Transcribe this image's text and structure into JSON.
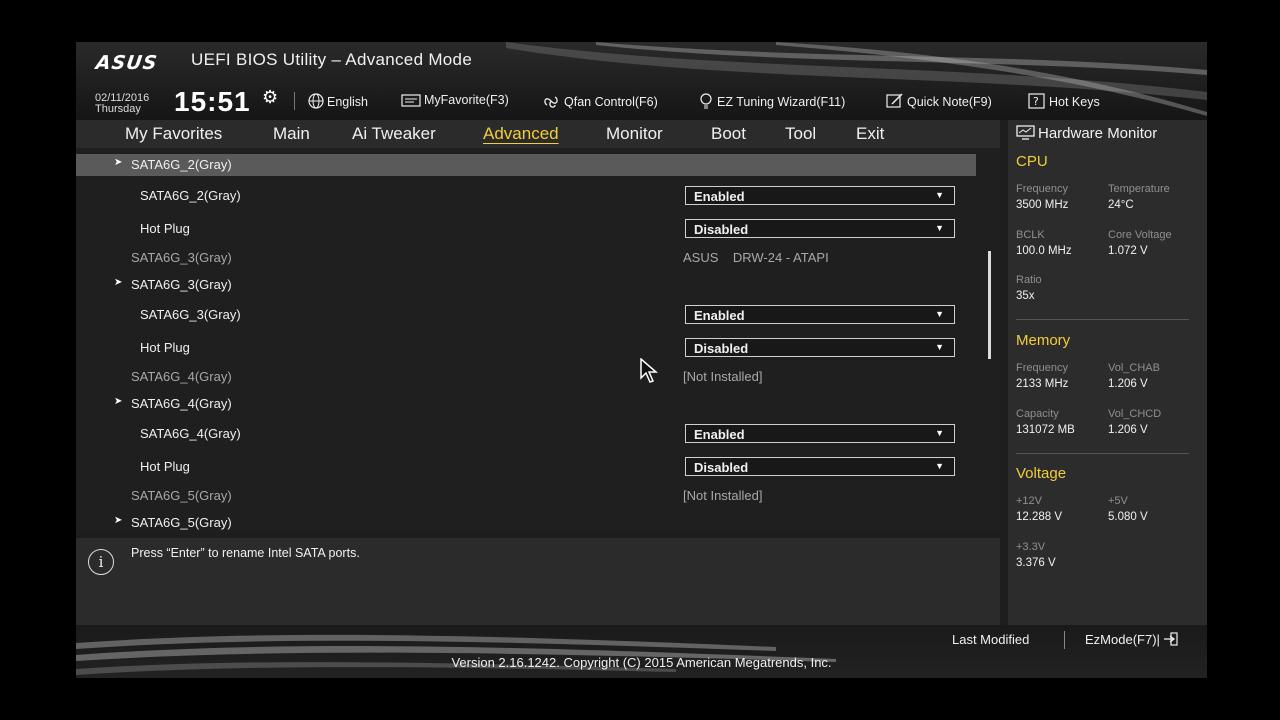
{
  "window": {
    "logo": "ASUS",
    "title": "UEFI BIOS Utility – Advanced Mode"
  },
  "clock": {
    "date": "02/11/2016",
    "weekday": "Thursday",
    "time": "15:51"
  },
  "toolbar": {
    "language": "English",
    "myfavorite": "MyFavorite(F3)",
    "qfan": "Qfan Control(F6)",
    "ez_tuning": "EZ Tuning Wizard(F11)",
    "quick_note": "Quick Note(F9)",
    "hot_keys": "Hot Keys"
  },
  "tabs": [
    "My Favorites",
    "Main",
    "Ai Tweaker",
    "Advanced",
    "Monitor",
    "Boot",
    "Tool",
    "Exit"
  ],
  "active_tab": "Advanced",
  "rows": [
    {
      "type": "header",
      "label": "SATA6G_2(Gray)",
      "highlighted": true
    },
    {
      "type": "setting",
      "label": "SATA6G_2(Gray)",
      "value": "Enabled"
    },
    {
      "type": "setting",
      "label": "Hot Plug",
      "value": "Disabled"
    },
    {
      "type": "info",
      "label": "SATA6G_3(Gray)",
      "value": "ASUS    DRW-24 - ATAPI"
    },
    {
      "type": "header",
      "label": "SATA6G_3(Gray)"
    },
    {
      "type": "setting",
      "label": "SATA6G_3(Gray)",
      "value": "Enabled"
    },
    {
      "type": "setting",
      "label": "Hot Plug",
      "value": "Disabled"
    },
    {
      "type": "info",
      "label": "SATA6G_4(Gray)",
      "value": "[Not Installed]"
    },
    {
      "type": "header",
      "label": "SATA6G_4(Gray)"
    },
    {
      "type": "setting",
      "label": "SATA6G_4(Gray)",
      "value": "Enabled"
    },
    {
      "type": "setting",
      "label": "Hot Plug",
      "value": "Disabled"
    },
    {
      "type": "info",
      "label": "SATA6G_5(Gray)",
      "value": "[Not Installed]"
    },
    {
      "type": "header",
      "label": "SATA6G_5(Gray)"
    }
  ],
  "help": {
    "text": "Press “Enter” to rename Intel SATA ports."
  },
  "hardware_monitor": {
    "title": "Hardware Monitor",
    "cpu": {
      "title": "CPU",
      "frequency_label": "Frequency",
      "frequency": "3500 MHz",
      "temperature_label": "Temperature",
      "temperature": "24°C",
      "bclk_label": "BCLK",
      "bclk": "100.0 MHz",
      "core_voltage_label": "Core Voltage",
      "core_voltage": "1.072 V",
      "ratio_label": "Ratio",
      "ratio": "35x"
    },
    "memory": {
      "title": "Memory",
      "frequency_label": "Frequency",
      "frequency": "2133 MHz",
      "vol_chab_label": "Vol_CHAB",
      "vol_chab": "1.206 V",
      "capacity_label": "Capacity",
      "capacity": "131072 MB",
      "vol_chcd_label": "Vol_CHCD",
      "vol_chcd": "1.206 V"
    },
    "voltage": {
      "title": "Voltage",
      "v12_label": "+12V",
      "v12": "12.288 V",
      "v5_label": "+5V",
      "v5": "5.080 V",
      "v33_label": "+3.3V",
      "v33": "3.376 V"
    }
  },
  "footer": {
    "last_modified": "Last Modified",
    "ezmode": "EzMode(F7)|",
    "version": "Version 2.16.1242. Copyright (C) 2015 American Megatrends, Inc."
  },
  "colors": {
    "accent": "#f2cd3c",
    "background": "#1f1f1f",
    "highlight_row": "#5a5a5a"
  }
}
